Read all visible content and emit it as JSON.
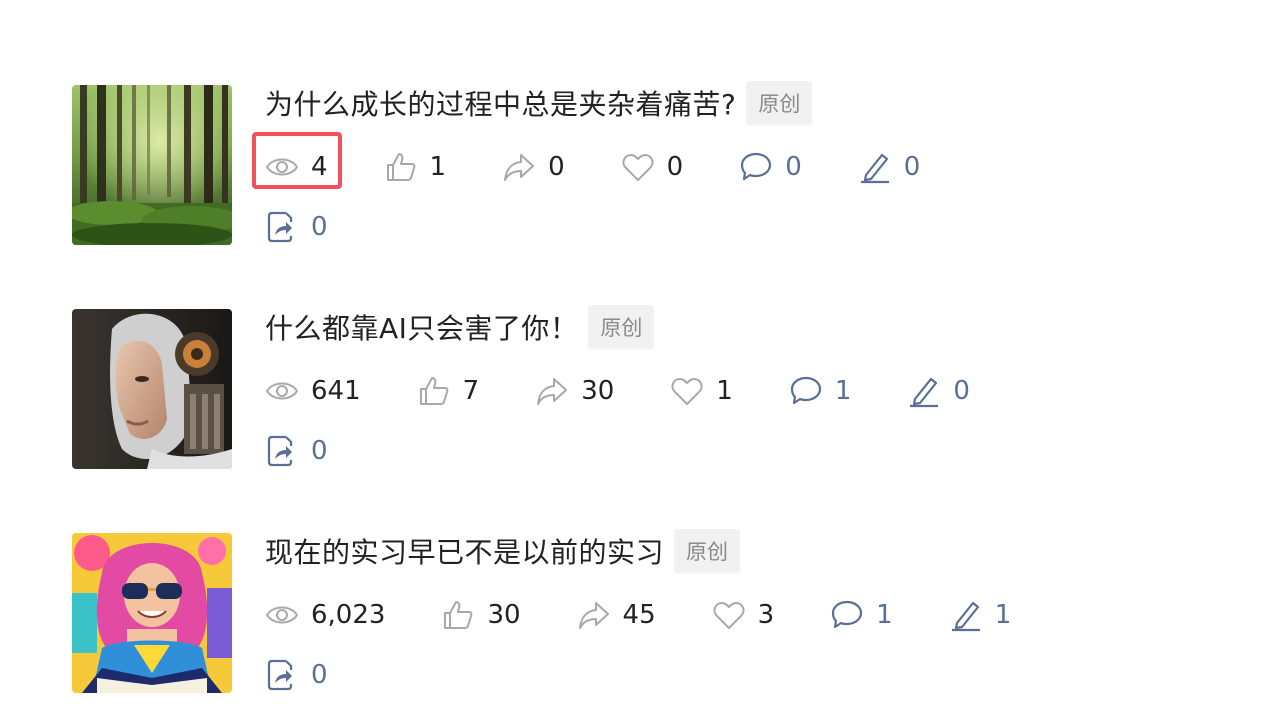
{
  "articles": [
    {
      "title": "为什么成长的过程中总是夹杂着痛苦?",
      "tag": "原创",
      "thumbnail": "forest-image",
      "stats": {
        "views": "4",
        "likes": "1",
        "shares": "0",
        "favorites": "0",
        "comments": "0",
        "edits": "0",
        "reposts": "0"
      }
    },
    {
      "title": "什么都靠AI只会害了你！",
      "tag": "原创",
      "thumbnail": "robot-face-image",
      "stats": {
        "views": "641",
        "likes": "7",
        "shares": "30",
        "favorites": "1",
        "comments": "1",
        "edits": "0",
        "reposts": "0"
      }
    },
    {
      "title": "现在的实习早已不是以前的实习",
      "tag": "原创",
      "thumbnail": "girl-with-sunglasses-image",
      "stats": {
        "views": "6,023",
        "likes": "30",
        "shares": "45",
        "favorites": "3",
        "comments": "1",
        "edits": "1",
        "reposts": "0"
      }
    }
  ],
  "colors": {
    "text": "#222222",
    "blue_stat": "#5a6f96",
    "gray_icon": "#a8a8a8",
    "tag_bg": "#f1f1f1",
    "highlight": "#f2535a"
  },
  "icons": [
    "eye-icon",
    "thumbs-up-icon",
    "share-arrow-icon",
    "heart-icon",
    "comment-icon",
    "pen-icon",
    "repost-icon"
  ]
}
